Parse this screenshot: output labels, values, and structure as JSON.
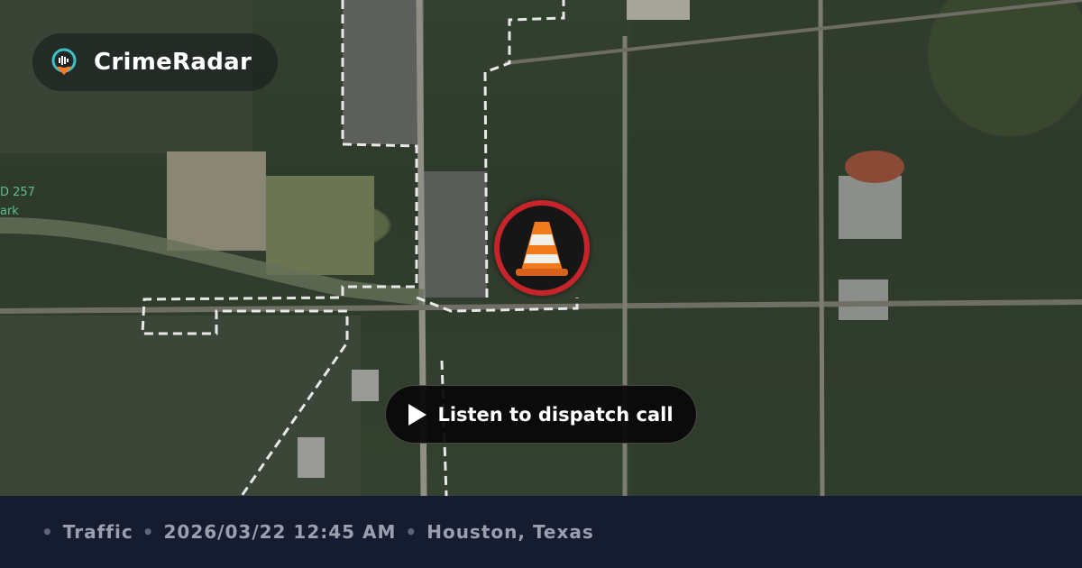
{
  "app": {
    "name": "CrimeRadar"
  },
  "map": {
    "left_edge_labels": [
      "D 257",
      "ark"
    ]
  },
  "incident": {
    "icon": "traffic-cone-icon",
    "accent": "#c4242a"
  },
  "listen_button": {
    "label": "Listen to dispatch call"
  },
  "footer": {
    "category": "Traffic",
    "datetime": "2026/03/22 12:45 AM",
    "location": "Houston, Texas"
  },
  "colors": {
    "footer_bg": "#161c30",
    "footer_text": "#9aa0ae",
    "marker_ring": "#c4242a"
  }
}
